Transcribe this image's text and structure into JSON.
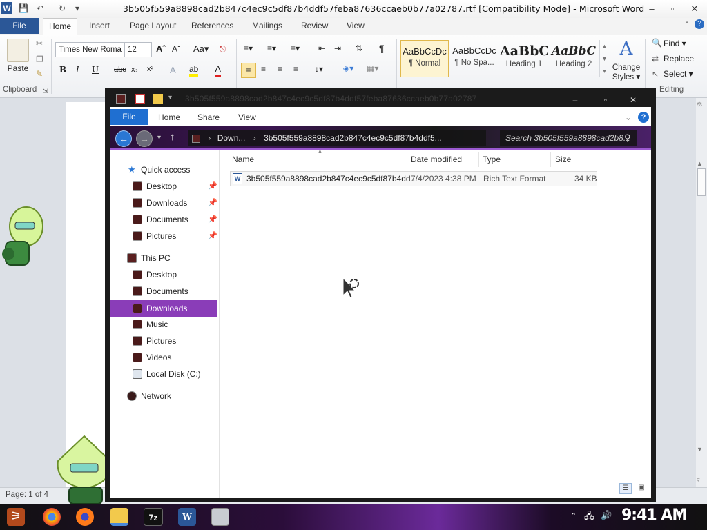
{
  "word": {
    "title": "3b505f559a8898cad2b847c4ec9c5df87b4ddf57feba87636ccaeb0b77a02787.rtf [Compatibility Mode] - Microsoft Word",
    "tabs": [
      "File",
      "Home",
      "Insert",
      "Page Layout",
      "References",
      "Mailings",
      "Review",
      "View"
    ],
    "ribbon": {
      "clipboard": {
        "paste": "Paste",
        "group": "Clipboard"
      },
      "font": {
        "name": "Times New Roma",
        "size": "12"
      },
      "styles": [
        {
          "sample": "AaBbCcDc",
          "name": "¶ Normal"
        },
        {
          "sample": "AaBbCcDc",
          "name": "¶ No Spa..."
        },
        {
          "sample": "AaBbC",
          "name": "Heading 1"
        },
        {
          "sample": "AaBbC",
          "name": "Heading 2"
        }
      ],
      "change_styles": [
        "Change",
        "Styles ▾"
      ],
      "editing": {
        "find": "Find ▾",
        "replace": "Replace",
        "select": "Select ▾",
        "group": "Editing"
      }
    },
    "status": {
      "page": "Page: 1 of 4"
    }
  },
  "explorer": {
    "title": "3b505f559a8898cad2b847c4ec9c5df87b4ddf57feba87636ccaeb0b77a02787",
    "tabs": [
      "File",
      "Home",
      "Share",
      "View"
    ],
    "address": [
      "Down...",
      "3b505f559a8898cad2b847c4ec9c5df87b4ddf5..."
    ],
    "search_placeholder": "Search 3b505f559a8898cad2b8...",
    "nav": {
      "quick_access": "Quick access",
      "quick_items": [
        "Desktop",
        "Downloads",
        "Documents",
        "Pictures"
      ],
      "this_pc": "This PC",
      "pc_items": [
        "Desktop",
        "Documents",
        "Downloads",
        "Music",
        "Pictures",
        "Videos",
        "Local Disk (C:)"
      ],
      "network": "Network",
      "selected": "Downloads"
    },
    "columns": [
      "Name",
      "Date modified",
      "Type",
      "Size"
    ],
    "files": [
      {
        "name": "3b505f559a8898cad2b847c4ec9c5df87b4dd...",
        "date": "7/4/2023 4:38 PM",
        "type": "Rich Text Format",
        "size": "34 KB"
      }
    ]
  },
  "taskbar": {
    "apps": [
      "chrome-icon",
      "firefox-icon",
      "file-explorer-icon",
      "7zip-icon",
      "word-icon",
      "app-icon"
    ],
    "seven_zip_label": "7z",
    "word_label": "W",
    "clock": "9:41 AM"
  },
  "colors": {
    "accent_purple": "#8a3db8",
    "word_blue": "#2b5797",
    "explorer_blue": "#1f6fd1"
  }
}
